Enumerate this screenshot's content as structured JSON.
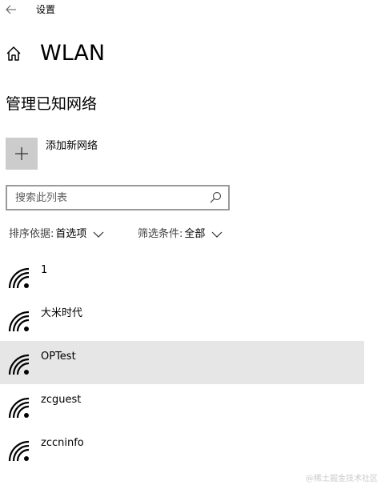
{
  "window": {
    "title": "设置"
  },
  "header": {
    "title": "WLAN"
  },
  "section": {
    "title": "管理已知网络"
  },
  "add_network": {
    "label": "添加新网络"
  },
  "search": {
    "placeholder": "搜索此列表",
    "value": ""
  },
  "sort": {
    "label": "排序依据:",
    "value": "首选项"
  },
  "filter": {
    "label": "筛选条件:",
    "value": "全部"
  },
  "networks": [
    {
      "name": "1",
      "selected": false,
      "signal_icon": "wifi-signal-icon"
    },
    {
      "name": "大米时代",
      "selected": false,
      "signal_icon": "wifi-signal-icon"
    },
    {
      "name": "OPTest",
      "selected": true,
      "signal_icon": "wifi-signal-icon"
    },
    {
      "name": "zcguest",
      "selected": false,
      "signal_icon": "wifi-signal-icon"
    },
    {
      "name": "zccninfo",
      "selected": false,
      "signal_icon": "wifi-signal-icon"
    }
  ],
  "watermark": "@稀土掘金技术社区",
  "colors": {
    "selected_row": "#e6e6e6",
    "add_tile": "#cccccc",
    "search_border": "#9a9a9a"
  }
}
